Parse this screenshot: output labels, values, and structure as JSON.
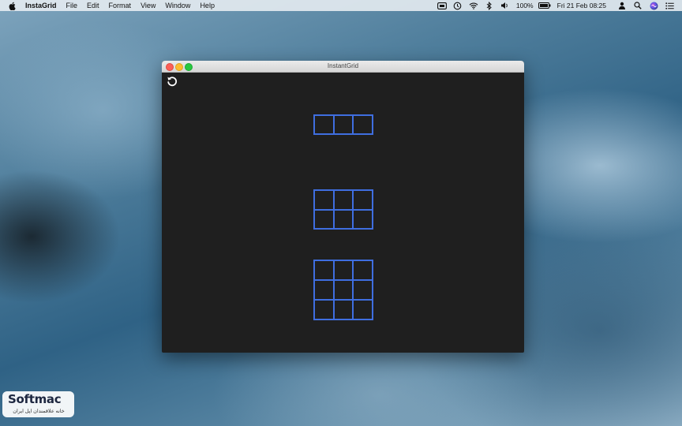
{
  "menubar": {
    "app_name": "InstaGrid",
    "menus": [
      "File",
      "Edit",
      "Format",
      "View",
      "Window",
      "Help"
    ],
    "battery_text": "100%",
    "clock": "Fri 21 Feb  08:25",
    "icons": [
      "apple-icon",
      "display-icon",
      "time-machine-icon",
      "wifi-icon",
      "bluetooth-icon",
      "volume-icon",
      "battery-icon",
      "user-icon",
      "search-icon",
      "siri-icon",
      "notification-center-icon"
    ]
  },
  "window": {
    "title": "InstantGrid",
    "refresh_icon": "refresh-icon",
    "grids": [
      {
        "name": "3x1",
        "columns": 3,
        "rows": 1
      },
      {
        "name": "3x2",
        "columns": 3,
        "rows": 2
      },
      {
        "name": "3x3",
        "columns": 3,
        "rows": 3
      }
    ],
    "accent_color": "#3f6ee0",
    "background_color": "#1f1f1f"
  },
  "watermark": {
    "brand": "Softmac",
    "subtitle": "خانه علاقمندان اپل ایران"
  }
}
